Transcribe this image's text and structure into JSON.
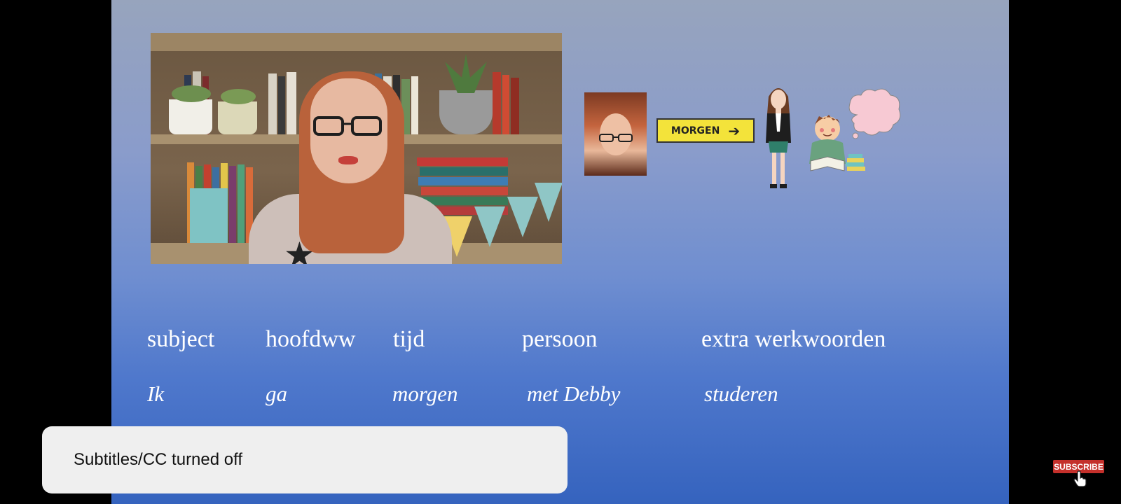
{
  "video": {
    "sign_text": "MORGEN",
    "headers": [
      "subject",
      "hoofdww",
      "tijd",
      "persoon",
      "extra werkwoorden"
    ],
    "values": [
      "Ik",
      "ga",
      "morgen",
      "met Debby",
      "studeren"
    ]
  },
  "toast": {
    "message": "Subtitles/CC turned off"
  },
  "subscribe": {
    "label": "SUBSCRIBE"
  },
  "colors": {
    "subscribe": "#c4302b",
    "sign": "#f3e33a",
    "toast": "#efefef"
  },
  "icons": {
    "cursor": "hand-pointer-icon",
    "arrow": "arrow-right-icon"
  }
}
